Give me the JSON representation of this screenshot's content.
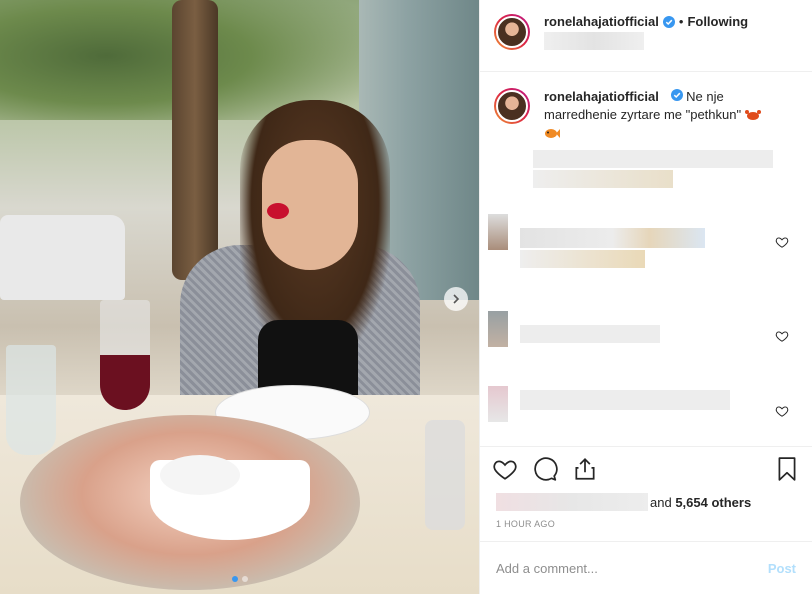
{
  "header": {
    "username": "ronelahajatiofficial",
    "separator": "•",
    "follow_status": "Following"
  },
  "caption": {
    "username": "ronelahajatiofficial",
    "text": "Ne nje marredhenie zyrtare me \"pethkun\""
  },
  "actions": {
    "like_icon": "heart-icon",
    "comment_icon": "comment-icon",
    "share_icon": "share-icon",
    "save_icon": "bookmark-icon"
  },
  "likes": {
    "prefix": "and ",
    "count": "5,654 others"
  },
  "timestamp": "1 HOUR AGO",
  "comment_box": {
    "placeholder": "Add a comment...",
    "post_label": "Post"
  },
  "carousel": {
    "current_index": 1,
    "total": 2
  },
  "colors": {
    "accent": "#3897f0",
    "post_disabled": "#b2dffc",
    "verified": "#3897f0"
  }
}
